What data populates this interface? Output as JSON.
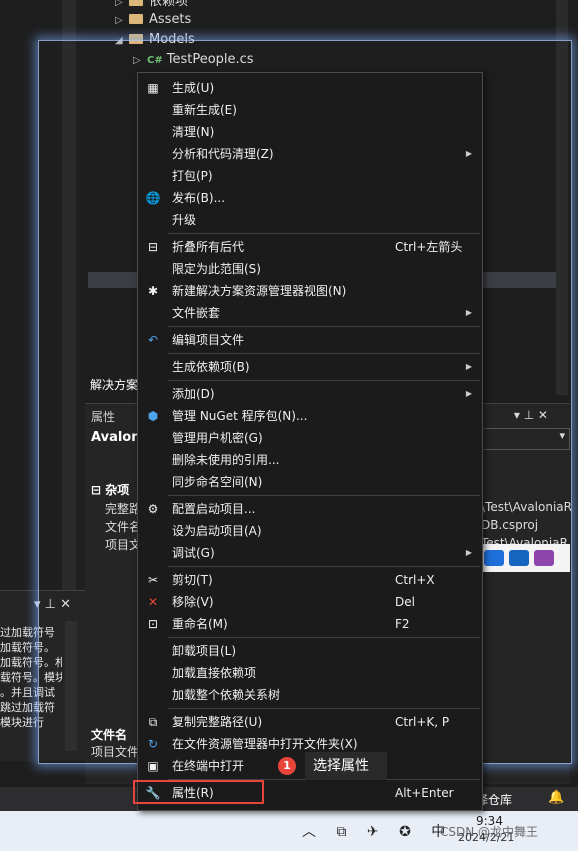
{
  "left_output": {
    "toolbar": "▾ ⊥ ✕",
    "lines": [
      "过加载符号",
      "加载符号。",
      "加载符号。札",
      "载符号。模块",
      "。并且调试",
      "跳过加载符",
      "模块进行"
    ]
  },
  "solution_explorer": {
    "rows": [
      {
        "tri": "▷",
        "label": "依赖项",
        "kind": "folder"
      },
      {
        "tri": "▷",
        "label": "Assets",
        "kind": "folder"
      },
      {
        "tri": "◢",
        "label": "Models",
        "kind": "folder"
      },
      {
        "tri": "▷",
        "label": "TestPeople.cs",
        "kind": "cs"
      }
    ],
    "tab_label": "解决方案"
  },
  "properties": {
    "header": "属性",
    "header_tools": "▾ ⊥ ✕",
    "object_name": "Avaloni",
    "category": "杂项",
    "rows": [
      {
        "name": "完整路",
        "value": "\\Test\\AvaloniaR"
      },
      {
        "name": "文件名",
        "value": "DB.csproj"
      },
      {
        "name": "项目文",
        "value": "Test\\AvaloniaR"
      }
    ],
    "desc_title": "文件名",
    "desc_text": "项目文件"
  },
  "menu": {
    "items": [
      {
        "icon": "▦",
        "icon_name": "build-icon",
        "label": "生成(U)",
        "shortcut": "",
        "submenu": false
      },
      {
        "icon": "",
        "icon_name": "",
        "label": "重新生成(E)",
        "shortcut": "",
        "submenu": false
      },
      {
        "icon": "",
        "icon_name": "",
        "label": "清理(N)",
        "shortcut": "",
        "submenu": false
      },
      {
        "icon": "",
        "icon_name": "",
        "label": "分析和代码清理(Z)",
        "shortcut": "",
        "submenu": true
      },
      {
        "icon": "",
        "icon_name": "",
        "label": "打包(P)",
        "shortcut": "",
        "submenu": false
      },
      {
        "icon": "🌐",
        "icon_name": "publish-icon",
        "label": "发布(B)...",
        "shortcut": "",
        "submenu": false
      },
      {
        "icon": "",
        "icon_name": "",
        "label": "升级",
        "shortcut": "",
        "submenu": false
      },
      {
        "sep": true
      },
      {
        "icon": "⊟",
        "icon_name": "collapse-icon",
        "label": "折叠所有后代",
        "shortcut": "Ctrl+左箭头",
        "submenu": false
      },
      {
        "icon": "",
        "icon_name": "",
        "label": "限定为此范围(S)",
        "shortcut": "",
        "submenu": false
      },
      {
        "icon": "✱",
        "icon_name": "new-view-icon",
        "label": "新建解决方案资源管理器视图(N)",
        "shortcut": "",
        "submenu": false
      },
      {
        "icon": "",
        "icon_name": "",
        "label": "文件嵌套",
        "shortcut": "",
        "submenu": true
      },
      {
        "sep": true
      },
      {
        "icon": "↶",
        "icon_name": "edit-project-icon",
        "label": "编辑项目文件",
        "shortcut": "",
        "submenu": false
      },
      {
        "sep": true
      },
      {
        "icon": "",
        "icon_name": "",
        "label": "生成依赖项(B)",
        "shortcut": "",
        "submenu": true
      },
      {
        "sep": true
      },
      {
        "icon": "",
        "icon_name": "",
        "label": "添加(D)",
        "shortcut": "",
        "submenu": true
      },
      {
        "icon": "⬢",
        "icon_name": "nuget-icon",
        "label": "管理 NuGet 程序包(N)...",
        "shortcut": "",
        "submenu": false
      },
      {
        "icon": "",
        "icon_name": "",
        "label": "管理用户机密(G)",
        "shortcut": "",
        "submenu": false
      },
      {
        "icon": "",
        "icon_name": "",
        "label": "删除未使用的引用...",
        "shortcut": "",
        "submenu": false
      },
      {
        "icon": "",
        "icon_name": "",
        "label": "同步命名空间(N)",
        "shortcut": "",
        "submenu": false
      },
      {
        "sep": true
      },
      {
        "icon": "⚙",
        "icon_name": "gear-icon",
        "label": "配置启动项目...",
        "shortcut": "",
        "submenu": false
      },
      {
        "icon": "",
        "icon_name": "",
        "label": "设为启动项目(A)",
        "shortcut": "",
        "submenu": false
      },
      {
        "icon": "",
        "icon_name": "",
        "label": "调试(G)",
        "shortcut": "",
        "submenu": true
      },
      {
        "sep": true
      },
      {
        "icon": "✂",
        "icon_name": "cut-icon",
        "label": "剪切(T)",
        "shortcut": "Ctrl+X",
        "submenu": false
      },
      {
        "icon": "✕",
        "icon_name": "remove-icon",
        "label": "移除(V)",
        "shortcut": "Del",
        "submenu": false
      },
      {
        "icon": "⊡",
        "icon_name": "rename-icon",
        "label": "重命名(M)",
        "shortcut": "F2",
        "submenu": false
      },
      {
        "sep": true
      },
      {
        "icon": "",
        "icon_name": "",
        "label": "卸载项目(L)",
        "shortcut": "",
        "submenu": false
      },
      {
        "icon": "",
        "icon_name": "",
        "label": "加载直接依赖项",
        "shortcut": "",
        "submenu": false
      },
      {
        "icon": "",
        "icon_name": "",
        "label": "加载整个依赖关系树",
        "shortcut": "",
        "submenu": false
      },
      {
        "sep": true
      },
      {
        "icon": "⧉",
        "icon_name": "copy-path-icon",
        "label": "复制完整路径(U)",
        "shortcut": "Ctrl+K, P",
        "submenu": false
      },
      {
        "icon": "↻",
        "icon_name": "open-folder-icon",
        "label": "在文件资源管理器中打开文件夹(X)",
        "shortcut": "",
        "submenu": false
      },
      {
        "icon": "▣",
        "icon_name": "terminal-icon",
        "label": "在终端中打开",
        "shortcut": "",
        "submenu": false
      },
      {
        "sep": true
      },
      {
        "icon": "🔧",
        "icon_name": "wrench-icon",
        "label": "属性(R)",
        "shortcut": "Alt+Enter",
        "submenu": false
      }
    ]
  },
  "annotation": {
    "badge": "1",
    "text": "选择属性"
  },
  "status_bar": {
    "repo": "择仓库",
    "bell": "🔔"
  },
  "taskbar": {
    "tray": "︿ ⧉ ✈ ✪ 中",
    "time": "9:34",
    "date": "2024/2/21",
    "watermark": "CSDN @龙中舞王"
  },
  "colors": {
    "accent_red": "#e8443a",
    "menu_bg": "#1b1b1c",
    "ide_bg": "#1e1e1e"
  }
}
